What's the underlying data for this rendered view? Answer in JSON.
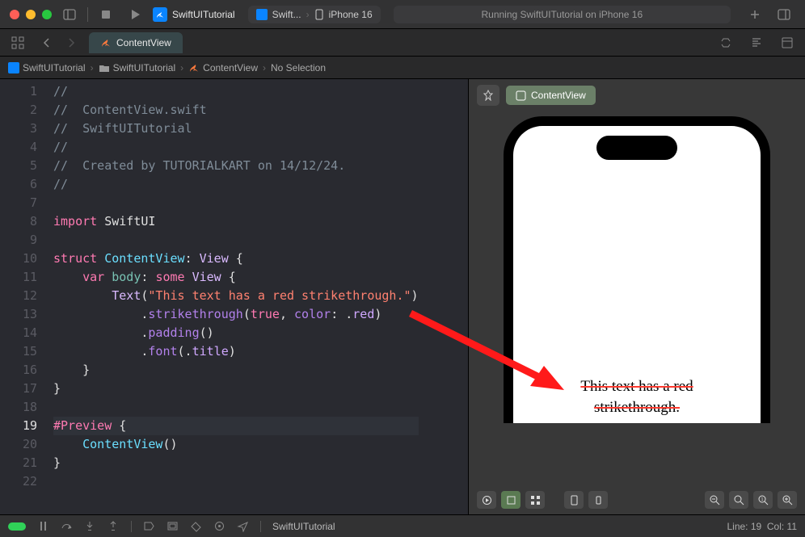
{
  "titlebar": {
    "project": "SwiftUITutorial",
    "scheme_app": "Swift...",
    "scheme_device": "iPhone 16",
    "status": "Running SwiftUITutorial on iPhone 16"
  },
  "tab": {
    "label": "ContentView"
  },
  "crumb": {
    "c1": "SwiftUITutorial",
    "c2": "SwiftUITutorial",
    "c3": "ContentView",
    "c4": "No Selection"
  },
  "code": {
    "l1": "//",
    "l2_a": "//  ",
    "l2_b": "ContentView.swift",
    "l3_a": "//  ",
    "l3_b": "SwiftUITutorial",
    "l4": "//",
    "l5_a": "//  ",
    "l5_b": "Created by TUTORIALKART on 14/12/24.",
    "l6": "//",
    "l8_kw": "import",
    "l8_m": " SwiftUI",
    "l10_kw": "struct ",
    "l10_t": "ContentView",
    "l10_r": ": ",
    "l10_v": "View",
    "l10_b": " {",
    "l11_pad": "    ",
    "l11_kw": "var ",
    "l11_id": "body",
    "l11_c": ": ",
    "l11_kw2": "some ",
    "l11_v": "View",
    "l11_b": " {",
    "l12_pad": "        ",
    "l12_t": "Text",
    "l12_p": "(",
    "l12_s": "\"This text has a red strikethrough.\"",
    "l12_e": ")",
    "l13_pad": "            .",
    "l13_fn": "strikethrough",
    "l13_a": "(",
    "l13_kw": "true",
    "l13_c": ", ",
    "l13_lbl": "color",
    "l13_c2": ": .",
    "l13_en": "red",
    "l13_e": ")",
    "l14_pad": "            .",
    "l14_fn": "padding",
    "l14_e": "()",
    "l15_pad": "            .",
    "l15_fn": "font",
    "l15_a": "(.",
    "l15_en": "title",
    "l15_e": ")",
    "l16": "    }",
    "l17": "}",
    "l19_kw": "#Preview",
    "l19_b": " {",
    "l20_pad": "    ",
    "l20_t": "ContentView",
    "l20_e": "()",
    "l21": "}"
  },
  "preview": {
    "tab": "ContentView",
    "text1": "This text has a red",
    "text2": "strikethrough."
  },
  "footer": {
    "project": "SwiftUITutorial",
    "line": "Line: 19",
    "col": "Col: 11"
  }
}
